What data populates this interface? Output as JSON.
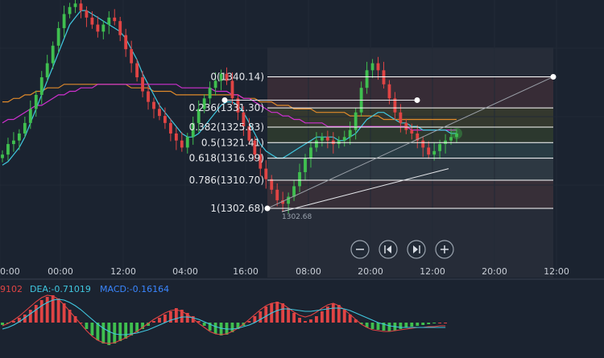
{
  "colors": {
    "background": "#1b2330",
    "up": "#3fbf4f",
    "down": "#e04444",
    "ma_fast": "#40c8e0",
    "ma_mid": "#e0892a",
    "ma_slow": "#d030d0",
    "fib_line": "#ffffff",
    "dif": "#e04444",
    "dea": "#40c8e0",
    "macd_label": "#3a86ff"
  },
  "time_axis": [
    "0:00",
    "00:00",
    "12:00",
    "04:00",
    "16:00",
    "08:00",
    "20:00",
    "12:00",
    "20:00",
    "12:00"
  ],
  "fib_levels": [
    {
      "label": "0(1340.14)",
      "ratio": 0,
      "price": 1340.14
    },
    {
      "label": "0.236(1331.30)",
      "ratio": 0.236,
      "price": 1331.3
    },
    {
      "label": "0.382(1325.83)",
      "ratio": 0.382,
      "price": 1325.83
    },
    {
      "label": "0.5(1321.41)",
      "ratio": 0.5,
      "price": 1321.41
    },
    {
      "label": "0.618(1316.99)",
      "ratio": 0.618,
      "price": 1316.99
    },
    {
      "label": "0.786(1310.70)",
      "ratio": 0.786,
      "price": 1310.7
    },
    {
      "label": "1(1302.68)",
      "ratio": 1,
      "price": 1302.68
    }
  ],
  "low_marker": "1302.68",
  "indicator": {
    "dif_text": "9102",
    "dea_text": "DEA:-0.71019",
    "macd_text": "MACD:-0.16164"
  },
  "controls": [
    {
      "name": "zoom-out-button",
      "icon": "minus-icon",
      "glyph": "−"
    },
    {
      "name": "step-back-button",
      "icon": "skip-back-icon",
      "glyph": "prev"
    },
    {
      "name": "step-forward-button",
      "icon": "skip-forward-icon",
      "glyph": "next"
    },
    {
      "name": "zoom-in-button",
      "icon": "plus-icon",
      "glyph": "+"
    }
  ],
  "chart_data": {
    "type": "candlestick",
    "fib_high": 1340.14,
    "fib_low": 1302.68,
    "price_range": [
      1283,
      1362
    ],
    "closes": [
      1318,
      1321,
      1322,
      1324,
      1327,
      1331,
      1335,
      1340,
      1344,
      1349,
      1354,
      1358,
      1360,
      1361,
      1359,
      1357,
      1355,
      1353,
      1355,
      1357,
      1356,
      1352,
      1348,
      1344,
      1340,
      1336,
      1333,
      1331,
      1329,
      1327,
      1324,
      1322,
      1320,
      1323,
      1327,
      1331,
      1334,
      1337,
      1339,
      1341,
      1339,
      1334,
      1330,
      1326,
      1322,
      1318,
      1314,
      1311,
      1308,
      1305,
      1304,
      1306,
      1309,
      1313,
      1317,
      1320,
      1322,
      1323,
      1322,
      1321,
      1322,
      1323,
      1325,
      1330,
      1337,
      1342,
      1344,
      1342,
      1338,
      1334,
      1330,
      1327,
      1325,
      1324,
      1322,
      1320,
      1318,
      1319,
      1321,
      1322,
      1323,
      1324
    ],
    "ma_fast": [
      1315,
      1316,
      1318,
      1320,
      1323,
      1327,
      1331,
      1335,
      1339,
      1343,
      1347,
      1351,
      1355,
      1357,
      1359,
      1359,
      1358,
      1357,
      1356,
      1355,
      1354,
      1353,
      1351,
      1348,
      1345,
      1341,
      1338,
      1335,
      1332,
      1330,
      1328,
      1326,
      1324,
      1323,
      1323,
      1324,
      1326,
      1328,
      1330,
      1332,
      1333,
      1333,
      1332,
      1330,
      1327,
      1324,
      1321,
      1319,
      1318,
      1317,
      1317,
      1318,
      1319,
      1320,
      1321,
      1322,
      1323,
      1323,
      1323,
      1323,
      1322,
      1322,
      1323,
      1324,
      1326,
      1328,
      1329,
      1330,
      1330,
      1329,
      1328,
      1327,
      1327,
      1326,
      1326,
      1325,
      1325,
      1325,
      1325,
      1325,
      1324,
      1324
    ],
    "ma_mid": [
      1333,
      1333,
      1334,
      1334,
      1335,
      1335,
      1336,
      1336,
      1337,
      1337,
      1337,
      1338,
      1338,
      1338,
      1338,
      1338,
      1338,
      1338,
      1338,
      1338,
      1338,
      1338,
      1338,
      1337,
      1337,
      1337,
      1337,
      1336,
      1336,
      1336,
      1336,
      1335,
      1335,
      1335,
      1335,
      1335,
      1335,
      1335,
      1335,
      1335,
      1335,
      1335,
      1335,
      1334,
      1334,
      1334,
      1333,
      1333,
      1333,
      1332,
      1332,
      1332,
      1331,
      1331,
      1331,
      1331,
      1330,
      1330,
      1330,
      1330,
      1330,
      1330,
      1329,
      1329,
      1329,
      1329,
      1329,
      1329,
      1328,
      1328,
      1328,
      1328,
      1328,
      1328,
      1328,
      1328,
      1328,
      1328,
      1328,
      1328,
      1328,
      1328
    ],
    "ma_slow": [
      1327,
      1328,
      1328,
      1329,
      1330,
      1331,
      1332,
      1332,
      1333,
      1334,
      1335,
      1335,
      1336,
      1336,
      1337,
      1337,
      1337,
      1338,
      1338,
      1338,
      1338,
      1338,
      1338,
      1338,
      1338,
      1338,
      1338,
      1338,
      1338,
      1338,
      1338,
      1338,
      1337,
      1337,
      1337,
      1337,
      1337,
      1337,
      1336,
      1336,
      1336,
      1335,
      1335,
      1334,
      1334,
      1333,
      1332,
      1331,
      1330,
      1330,
      1329,
      1329,
      1328,
      1328,
      1327,
      1327,
      1327,
      1327,
      1326,
      1326,
      1326,
      1326,
      1326,
      1326,
      1326,
      1326,
      1326,
      1326,
      1326,
      1326,
      1326,
      1326,
      1326,
      1325,
      1325,
      1325,
      1325,
      1325,
      1325,
      1325,
      1325,
      1325
    ],
    "macd_hist": [
      -0.3,
      -0.1,
      0.2,
      0.6,
      1.0,
      1.6,
      2.2,
      2.8,
      3.2,
      3.4,
      3.0,
      2.4,
      1.6,
      0.8,
      0.0,
      -0.8,
      -1.6,
      -2.2,
      -2.6,
      -2.8,
      -2.6,
      -2.3,
      -2.0,
      -1.6,
      -1.2,
      -0.8,
      -0.4,
      0.2,
      0.6,
      1.0,
      1.4,
      1.8,
      1.6,
      1.2,
      0.8,
      0.2,
      -0.4,
      -1.0,
      -1.4,
      -1.6,
      -1.5,
      -1.2,
      -0.8,
      -0.4,
      0.2,
      0.8,
      1.4,
      2.0,
      2.4,
      2.6,
      2.4,
      1.8,
      1.2,
      0.6,
      0.2,
      0.4,
      0.8,
      1.4,
      2.0,
      2.4,
      2.2,
      1.6,
      1.0,
      0.4,
      -0.2,
      -0.6,
      -0.8,
      -0.9,
      -1.0,
      -1.1,
      -1.0,
      -0.8,
      -0.6,
      -0.5,
      -0.4,
      -0.3,
      -0.2,
      -0.1,
      0.0,
      0.0
    ],
    "dif": [
      -0.4,
      -0.1,
      0.3,
      0.8,
      1.4,
      2.0,
      2.6,
      3.1,
      3.4,
      3.3,
      2.9,
      2.2,
      1.4,
      0.6,
      -0.2,
      -1.0,
      -1.7,
      -2.2,
      -2.5,
      -2.6,
      -2.5,
      -2.2,
      -1.9,
      -1.5,
      -1.1,
      -0.6,
      -0.1,
      0.4,
      0.8,
      1.2,
      1.5,
      1.6,
      1.4,
      1.0,
      0.5,
      -0.1,
      -0.6,
      -1.1,
      -1.4,
      -1.5,
      -1.4,
      -1.1,
      -0.7,
      -0.2,
      0.4,
      1.0,
      1.6,
      2.1,
      2.4,
      2.5,
      2.3,
      1.8,
      1.3,
      0.9,
      0.7,
      0.9,
      1.3,
      1.8,
      2.2,
      2.4,
      2.1,
      1.6,
      1.0,
      0.4,
      -0.2,
      -0.6,
      -0.9,
      -1.0,
      -1.1,
      -1.1,
      -1.0,
      -0.9,
      -0.8,
      -0.7,
      -0.6,
      -0.6,
      -0.5,
      -0.5,
      -0.4,
      -0.4
    ],
    "dea": [
      -0.8,
      -0.6,
      -0.3,
      0.1,
      0.6,
      1.1,
      1.6,
      2.1,
      2.5,
      2.8,
      2.9,
      2.8,
      2.5,
      2.1,
      1.6,
      1.0,
      0.4,
      -0.2,
      -0.7,
      -1.1,
      -1.4,
      -1.5,
      -1.5,
      -1.4,
      -1.3,
      -1.1,
      -0.9,
      -0.6,
      -0.3,
      0.0,
      0.3,
      0.5,
      0.7,
      0.7,
      0.6,
      0.4,
      0.1,
      -0.2,
      -0.5,
      -0.7,
      -0.8,
      -0.8,
      -0.7,
      -0.5,
      -0.3,
      0.0,
      0.4,
      0.8,
      1.2,
      1.5,
      1.7,
      1.7,
      1.6,
      1.5,
      1.4,
      1.4,
      1.5,
      1.6,
      1.7,
      1.8,
      1.8,
      1.7,
      1.5,
      1.2,
      0.9,
      0.6,
      0.3,
      0.0,
      -0.2,
      -0.4,
      -0.5,
      -0.6,
      -0.6,
      -0.6,
      -0.6,
      -0.6,
      -0.6,
      -0.6,
      -0.6,
      -0.6
    ]
  }
}
